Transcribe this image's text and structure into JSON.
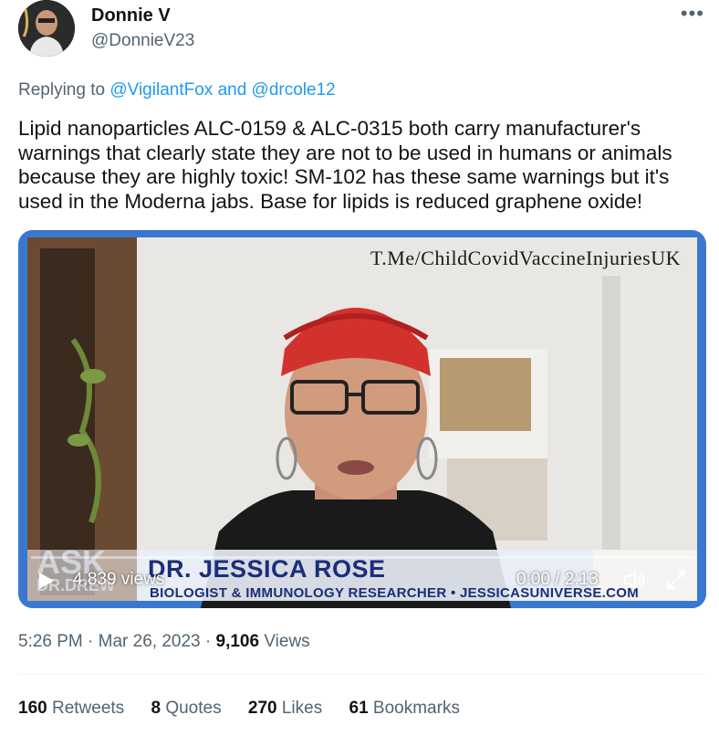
{
  "author": {
    "name": "Donnie V",
    "handle": "@DonnieV23"
  },
  "reply": {
    "prefix": "Replying to",
    "user1": "@VigilantFox",
    "joiner": "and",
    "user2": "@drcole12"
  },
  "tweet": {
    "text": "Lipid nanoparticles ALC-0159 & ALC-0315 both carry manufacturer's warnings that clearly state they are not to be used in humans or animals because they are highly toxic! SM-102 has these same warnings but it's used in the Moderna jabs. Base for lipids is reduced graphene oxide!"
  },
  "video": {
    "watermark": "T.Me/ChildCovidVaccineInjuriesUK",
    "lower_third_name": "DR. JESSICA ROSE",
    "lower_third_subtitle": "BIOLOGIST & IMMUNOLOGY RESEARCHER • JESSICASUNIVERSE.COM",
    "brand_top": "ASK",
    "brand_bottom": "DR.DREW",
    "views": "4,839 views",
    "time": "0:00 / 2:13",
    "progress": 0
  },
  "meta": {
    "time": "5:26 PM",
    "sep1": " · ",
    "date": "Mar 26, 2023",
    "sep2": " · ",
    "views_count": "9,106",
    "views_label": "Views"
  },
  "stats": {
    "retweets_count": "160",
    "retweets_label": "Retweets",
    "quotes_count": "8",
    "quotes_label": "Quotes",
    "likes_count": "270",
    "likes_label": "Likes",
    "bookmarks_count": "61",
    "bookmarks_label": "Bookmarks"
  },
  "icons": {
    "more": "more-horizontal-icon",
    "play": "play-icon",
    "volume": "volume-icon",
    "fullscreen": "fullscreen-icon"
  },
  "colors": {
    "link": "#1d9bf0",
    "secondary_text": "#536471",
    "primary_text": "#0f1419",
    "video_frame": "#2f6fc7"
  }
}
